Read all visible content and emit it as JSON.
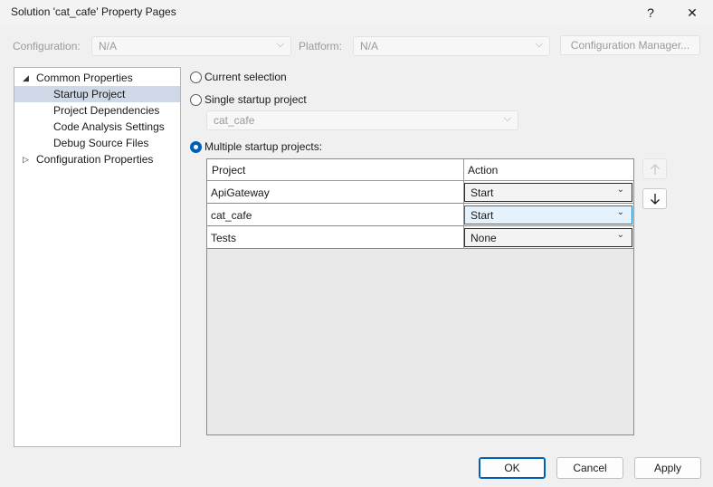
{
  "window": {
    "title": "Solution 'cat_cafe' Property Pages",
    "help_glyph": "?",
    "close_glyph": "✕"
  },
  "top": {
    "configuration_label": "Configuration:",
    "configuration_value": "N/A",
    "platform_label": "Platform:",
    "platform_value": "N/A",
    "config_manager_label": "Configuration Manager..."
  },
  "tree": {
    "common": "Common Properties",
    "startup": "Startup Project",
    "deps": "Project Dependencies",
    "analysis": "Code Analysis Settings",
    "debug": "Debug Source Files",
    "config": "Configuration Properties"
  },
  "options": {
    "current_selection": "Current selection",
    "single": "Single startup project",
    "single_value": "cat_cafe",
    "multiple": "Multiple startup projects:",
    "selected": "multiple"
  },
  "grid": {
    "col_project": "Project",
    "col_action": "Action",
    "rows": [
      {
        "project": "ApiGateway",
        "action": "Start"
      },
      {
        "project": "cat_cafe",
        "action": "Start"
      },
      {
        "project": "Tests",
        "action": "None"
      }
    ]
  },
  "buttons": {
    "ok": "OK",
    "cancel": "Cancel",
    "apply": "Apply"
  },
  "colors": {
    "accent": "#005fb8",
    "selection": "#cfd8e6"
  }
}
